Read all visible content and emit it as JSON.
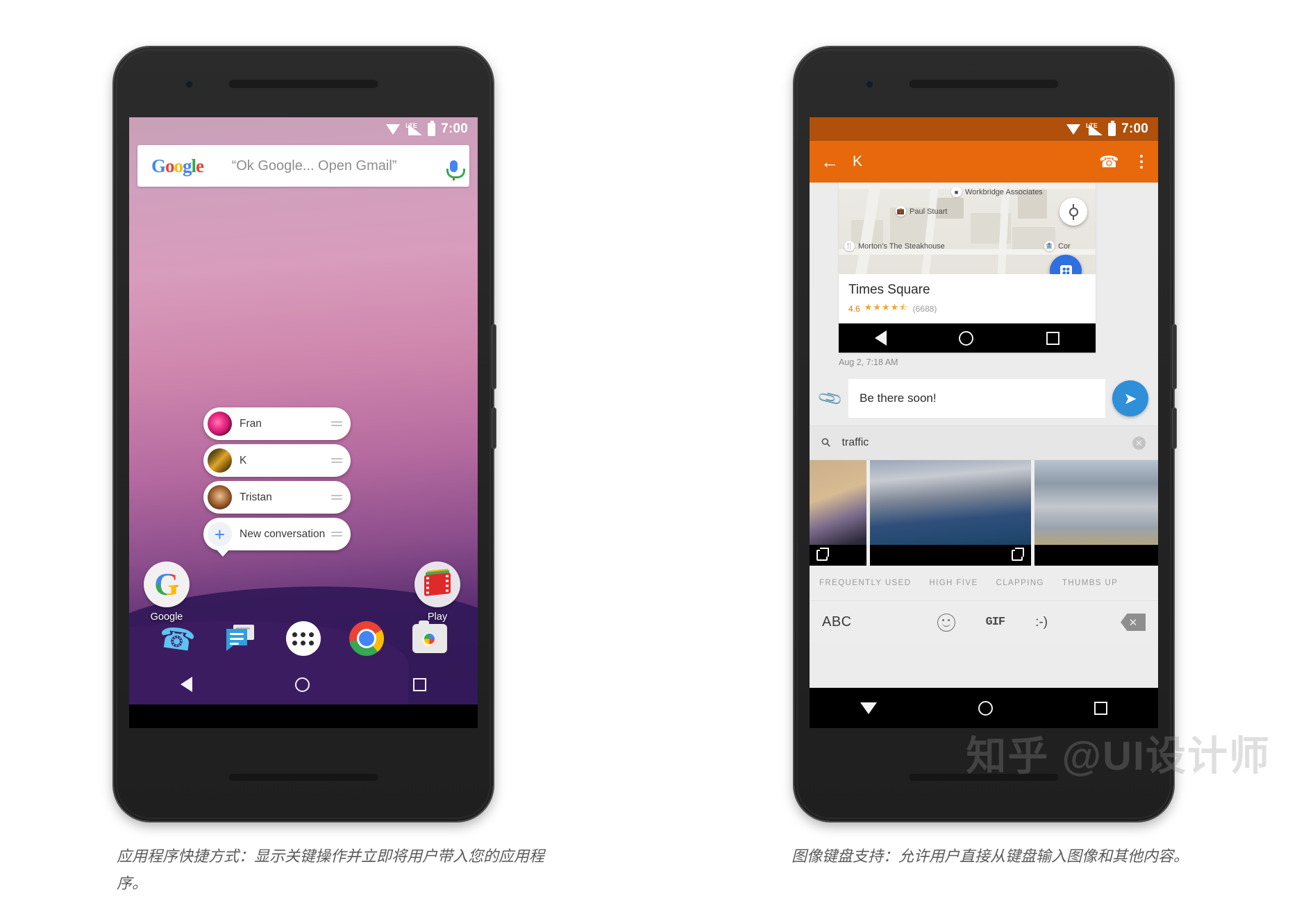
{
  "status_bar": {
    "time": "7:00",
    "network": "LTE",
    "icons": [
      "wifi-icon",
      "signal-icon",
      "battery-icon"
    ]
  },
  "left_phone": {
    "search_widget": {
      "logo": "Google",
      "logo_letters": [
        "G",
        "o",
        "o",
        "g",
        "l",
        "e"
      ],
      "query_hint": "“Ok Google... Open Gmail”",
      "mic_icon": "microphone-icon"
    },
    "shortcuts": [
      {
        "label": "Fran",
        "avatar": "contact-avatar-fran",
        "handle": "drag-handle"
      },
      {
        "label": "K",
        "avatar": "contact-avatar-k",
        "handle": "drag-handle"
      },
      {
        "label": "Tristan",
        "avatar": "contact-avatar-tristan",
        "handle": "drag-handle"
      },
      {
        "label": "New conversation",
        "avatar": "plus-icon",
        "handle": "drag-handle"
      }
    ],
    "apps": [
      {
        "label": "Google",
        "icon": "google-icon"
      },
      {
        "label": "Play",
        "icon": "play-movies-icon"
      }
    ],
    "dock": [
      {
        "name": "phone-icon",
        "glyph": "✆"
      },
      {
        "name": "messages-icon",
        "glyph": ""
      },
      {
        "name": "app-drawer-icon",
        "glyph": ""
      },
      {
        "name": "chrome-icon",
        "glyph": ""
      },
      {
        "name": "camera-icon",
        "glyph": ""
      }
    ],
    "navbar": [
      {
        "name": "nav-back-icon"
      },
      {
        "name": "nav-home-icon"
      },
      {
        "name": "nav-recents-icon"
      }
    ]
  },
  "right_phone": {
    "appbar": {
      "back_icon": "back-arrow-icon",
      "title": "K",
      "call_icon": "phone-call-icon",
      "more_icon": "overflow-menu-icon"
    },
    "map_card": {
      "pois": [
        {
          "label": "Workbridge Associates",
          "icon": "office-icon"
        },
        {
          "label": "Paul Stuart",
          "icon": "shop-icon"
        },
        {
          "label": "Morton's The Steakhouse",
          "icon": "restaurant-icon"
        },
        {
          "label": "Cor",
          "icon": "place-icon"
        }
      ],
      "my_location_icon": "my-location-icon",
      "transit_icon": "transit-icon",
      "place_name": "Times Square",
      "rating": "4.6",
      "stars": "★★★★⯪",
      "review_count": "(6688)"
    },
    "message_timestamp": "Aug 2, 7:18 AM",
    "composer": {
      "attach_icon": "attachment-icon",
      "text": "Be there soon!",
      "send_icon": "send-icon"
    },
    "image_search": {
      "search_icon": "search-icon",
      "query": "traffic",
      "clear_icon": "clear-icon",
      "results": [
        {
          "name": "traffic-thumbnail-1",
          "expand_icon": "open-in-new-icon"
        },
        {
          "name": "traffic-thumbnail-2",
          "expand_icon": "open-in-new-icon"
        },
        {
          "name": "traffic-thumbnail-3",
          "expand_icon": "open-in-new-icon"
        }
      ]
    },
    "keyboard": {
      "tabs": [
        "FREQUENTLY USED",
        "HIGH FIVE",
        "CLAPPING",
        "THUMBS UP"
      ],
      "abc_label": "ABC",
      "emoji_icon": "emoji-icon",
      "gif_label": "GIF",
      "smiley_label": ":-)",
      "backspace_icon": "backspace-icon"
    },
    "navbar": [
      {
        "name": "nav-hide-keyboard-icon"
      },
      {
        "name": "nav-home-icon"
      },
      {
        "name": "nav-recents-icon"
      }
    ]
  },
  "captions": {
    "left": "应用程序快捷方式：显示关键操作并立即将用户带入您的应用程序。",
    "right": "图像键盘支持：允许用户直接从键盘输入图像和其他内容。"
  },
  "watermark": "知乎 @UI设计师",
  "colors": {
    "appbar_orange": "#E8690B",
    "send_blue": "#2f8fd8",
    "accent_blue": "#2f6fe0",
    "rating_orange": "#e8710a"
  }
}
